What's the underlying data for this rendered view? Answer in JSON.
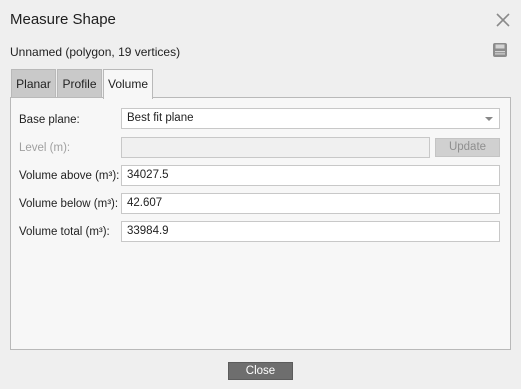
{
  "window": {
    "title": "Measure Shape",
    "subtitle": "Unnamed (polygon, 19 vertices)"
  },
  "tabs": [
    {
      "label": "Planar",
      "active": false
    },
    {
      "label": "Profile",
      "active": false
    },
    {
      "label": "Volume",
      "active": true
    }
  ],
  "volume": {
    "base_plane_label": "Base plane:",
    "base_plane_value": "Best fit plane",
    "level_label": "Level (m):",
    "level_value": "",
    "update_label": "Update",
    "volume_above_label": "Volume above (m³):",
    "volume_above_value": "34027.5",
    "volume_below_label": "Volume below (m³):",
    "volume_below_value": "42.607",
    "volume_total_label": "Volume total (m³):",
    "volume_total_value": "33984.9"
  },
  "footer": {
    "close_label": "Close"
  },
  "icons": {
    "close": "close-icon",
    "save": "save-icon",
    "dropdown": "chevron-down-icon"
  },
  "colors": {
    "close_button_bg": "#6e6e6e",
    "active_tab_bg": "#f7f7f7",
    "inactive_tab_bg": "#c9c9c9"
  }
}
